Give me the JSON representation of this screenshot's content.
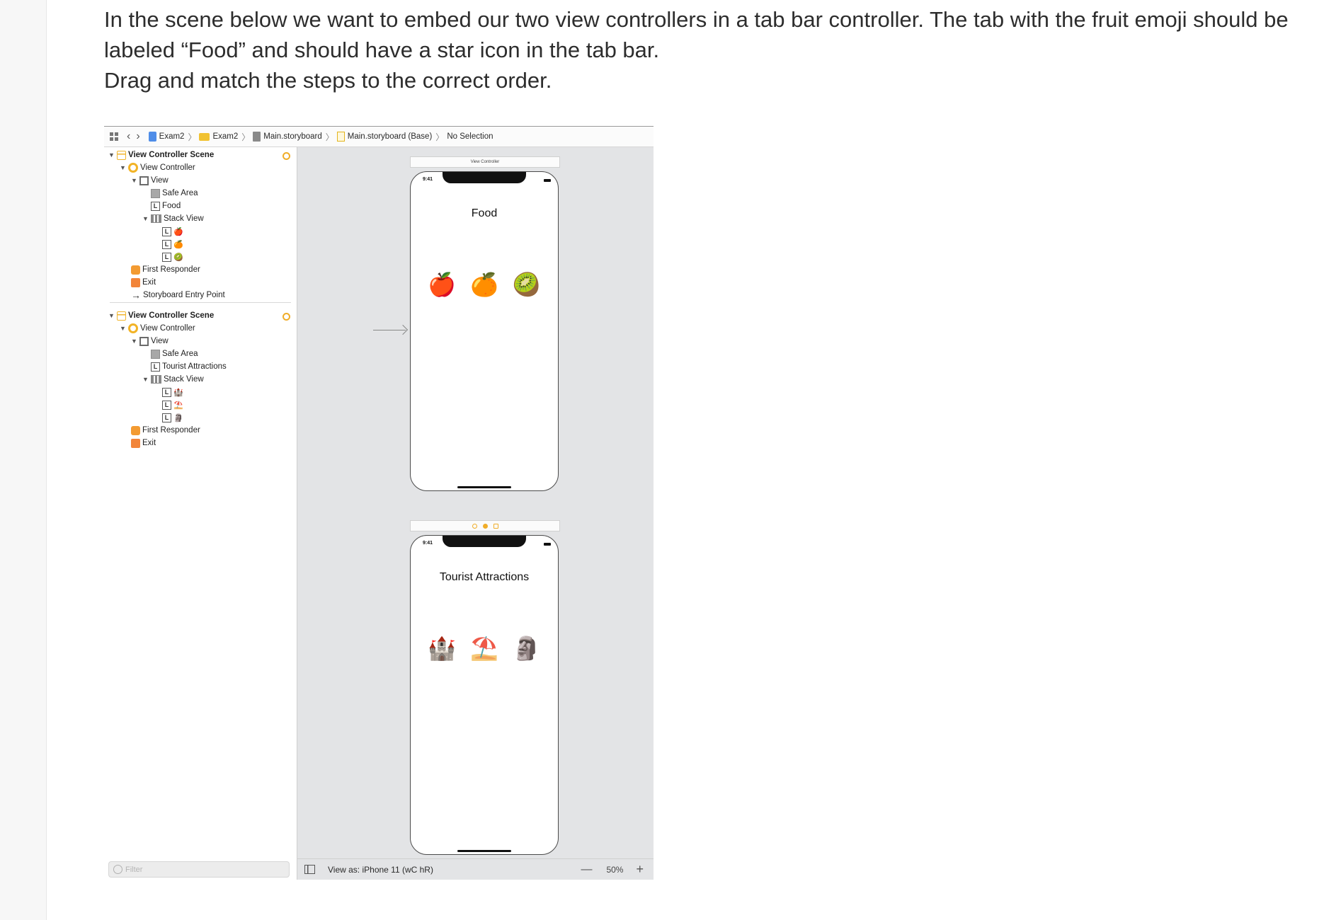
{
  "question": {
    "line1": "In the scene below we want to embed our two view controllers in a tab bar controller. The tab with the fruit emoji should be labeled “Food” and should have a star icon in the tab bar.",
    "line2": "Drag and match the steps to the correct order."
  },
  "xcode": {
    "breadcrumb": {
      "project": "Exam2",
      "group": "Exam2",
      "file": "Main.storyboard",
      "base": "Main.storyboard (Base)",
      "selection": "No Selection"
    },
    "outline": {
      "scene1": {
        "title": "View Controller Scene",
        "vc": "View Controller",
        "view": "View",
        "safe_area": "Safe Area",
        "label": "Food",
        "stack": "Stack View",
        "items": [
          "🍎",
          "🍊",
          "🥝"
        ],
        "first_responder": "First Responder",
        "exit": "Exit",
        "entry": "Storyboard Entry Point"
      },
      "scene2": {
        "title": "View Controller Scene",
        "vc": "View Controller",
        "view": "View",
        "safe_area": "Safe Area",
        "label": "Tourist Attractions",
        "stack": "Stack View",
        "items": [
          "🏰",
          "⛱️",
          "🗿"
        ],
        "first_responder": "First Responder",
        "exit": "Exit"
      },
      "filter_placeholder": "Filter"
    },
    "canvas": {
      "phone1": {
        "header": "View Controller",
        "time": "9:41",
        "title": "Food",
        "emojis": [
          "🍎",
          "🍊",
          "🥝"
        ]
      },
      "phone2": {
        "time": "9:41",
        "title": "Tourist Attractions",
        "emojis": [
          "🏰",
          "⛱️",
          "🗿"
        ]
      }
    },
    "bottom_bar": {
      "view_as": "View as: iPhone 11 (wC hR)",
      "zoom": "50%"
    }
  }
}
